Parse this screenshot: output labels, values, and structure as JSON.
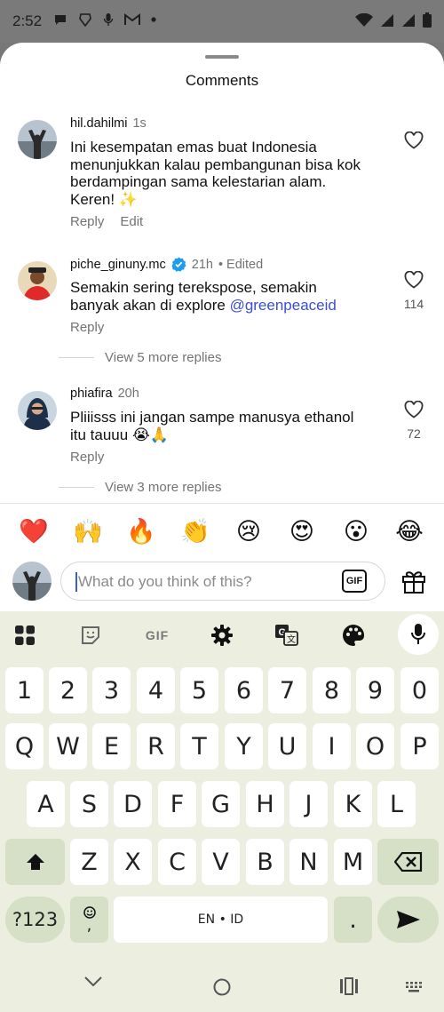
{
  "status": {
    "time": "2:52"
  },
  "sheet": {
    "title": "Comments"
  },
  "comments": [
    {
      "username": "hil.dahilmi",
      "time": "1s",
      "body_lines": [
        "Ini kesempatan emas buat Indonesia",
        "menunjukkan kalau pembangunan bisa kok",
        "berdampingan sama kelestarian alam.",
        "Keren! ✨"
      ],
      "reply_label": "Reply",
      "edit_label": "Edit"
    },
    {
      "username": "piche_ginuny.mc",
      "time": "21h",
      "edited": "• Edited",
      "body_line1": "Semakin sering terekspose, semakin",
      "body_line2_text": "banyak akan di explore ",
      "mention": "@greenpeaceid",
      "reply_label": "Reply",
      "likes": "114",
      "view_replies": "View 5 more replies"
    },
    {
      "username": "phiafira",
      "time": "20h",
      "body_lines": [
        "Pliiisss ini jangan sampe manusya ethanol",
        "itu tauuu 😭🙏"
      ],
      "reply_label": "Reply",
      "likes": "72",
      "view_replies": "View 3 more replies"
    }
  ],
  "emojis": [
    "❤️",
    "🙌",
    "🔥",
    "👏",
    "😢",
    "😍",
    "😮",
    "😂"
  ],
  "composer": {
    "placeholder": "What do you think of this?",
    "gif_label": "GIF"
  },
  "keyboard": {
    "toolbar_gif": "GIF",
    "row_numbers": [
      "1",
      "2",
      "3",
      "4",
      "5",
      "6",
      "7",
      "8",
      "9",
      "0"
    ],
    "row_q": [
      "Q",
      "W",
      "E",
      "R",
      "T",
      "Y",
      "U",
      "I",
      "O",
      "P"
    ],
    "row_a": [
      "A",
      "S",
      "D",
      "F",
      "G",
      "H",
      "J",
      "K",
      "L"
    ],
    "row_z": [
      "Z",
      "X",
      "C",
      "V",
      "B",
      "N",
      "M"
    ],
    "symbols_label": "?123",
    "emoji_comma": ",",
    "space_label": "EN • ID",
    "period_label": "."
  },
  "colors": {
    "mention": "#3a4fd0",
    "verified": "#1d9bf0",
    "keyboard_bg": "#ecefe0",
    "special_key": "#d5e0c6"
  },
  "icons": [
    "messages-icon",
    "brave-icon",
    "mic-notif-icon",
    "gmail-icon",
    "dot-icon",
    "wifi-icon",
    "signal-icon",
    "battery-icon",
    "heart-icon",
    "verified-badge-icon",
    "gift-icon",
    "apps-grid-icon",
    "sticker-icon",
    "settings-gear-icon",
    "translate-icon",
    "palette-icon",
    "microphone-icon",
    "shift-icon",
    "backspace-icon",
    "send-arrow-icon",
    "nav-back-icon",
    "nav-home-icon",
    "nav-recents-icon",
    "keyboard-switch-icon"
  ]
}
